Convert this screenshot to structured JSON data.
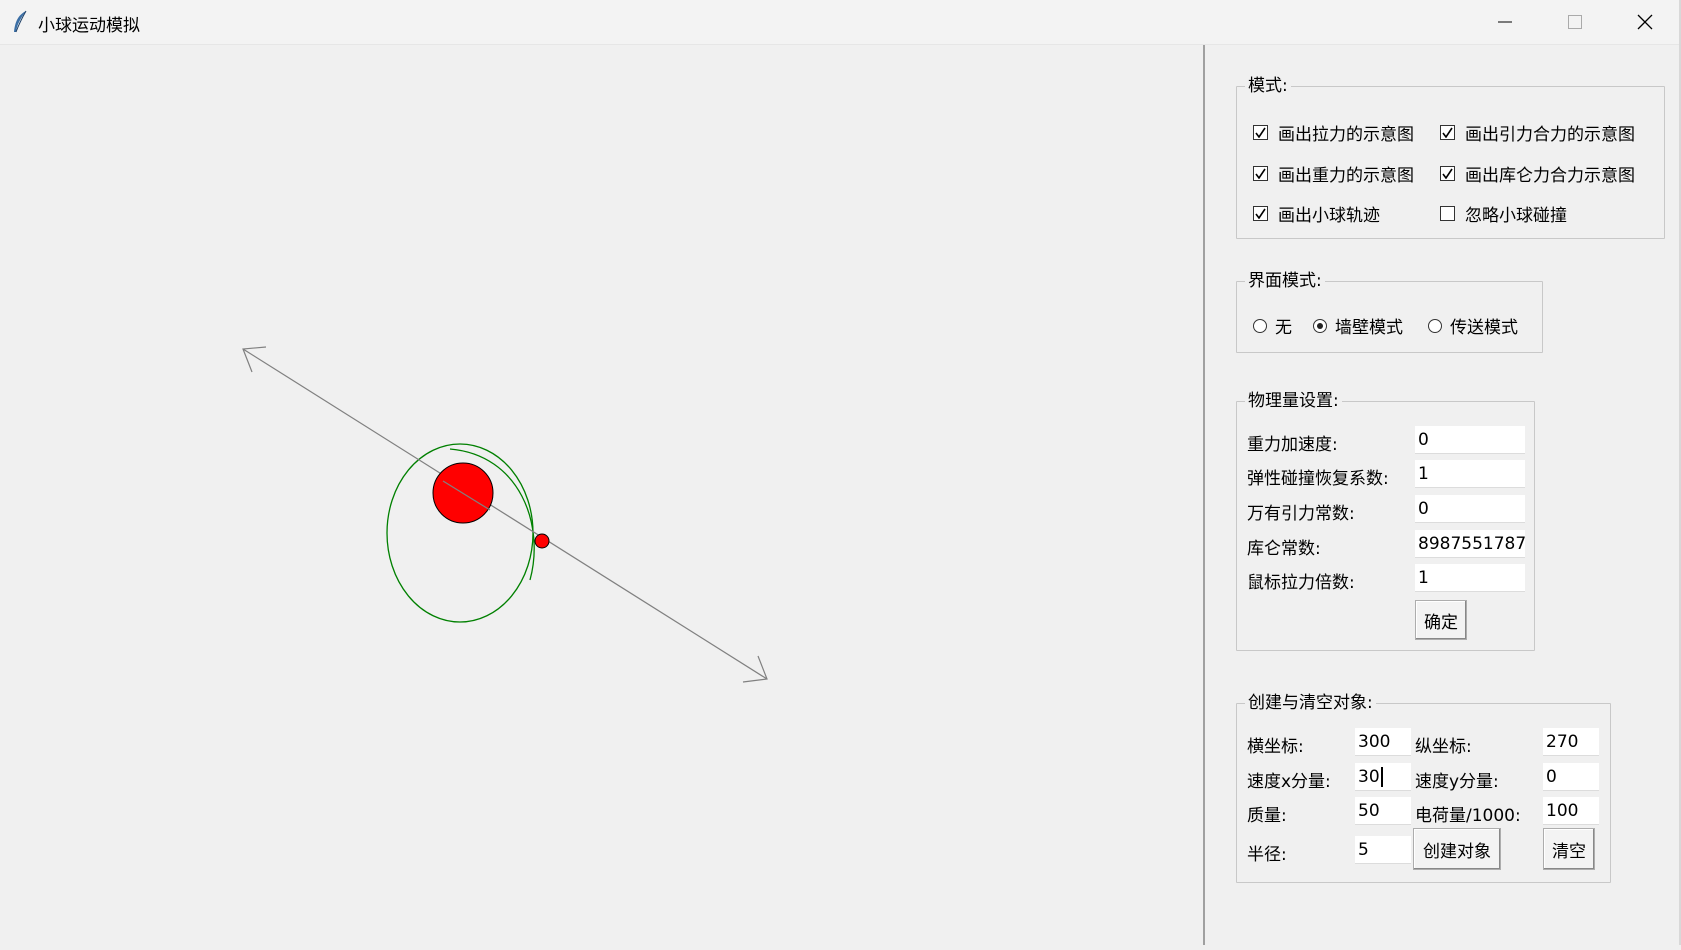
{
  "window": {
    "title": "小球运动模拟"
  },
  "mode_group": {
    "legend": "模式:",
    "checkboxes": [
      {
        "label": "画出拉力的示意图",
        "checked": true
      },
      {
        "label": "画出引力合力的示意图",
        "checked": true
      },
      {
        "label": "画出重力的示意图",
        "checked": true
      },
      {
        "label": "画出库仑力合力示意图",
        "checked": true
      },
      {
        "label": "画出小球轨迹",
        "checked": true
      },
      {
        "label": "忽略小球碰撞",
        "checked": false
      }
    ]
  },
  "boundary_group": {
    "legend": "界面模式:",
    "options": [
      {
        "label": "无",
        "selected": false
      },
      {
        "label": "墙壁模式",
        "selected": true
      },
      {
        "label": "传送模式",
        "selected": false
      }
    ]
  },
  "physics_group": {
    "legend": "物理量设置:",
    "fields": [
      {
        "label": "重力加速度:",
        "value": "0"
      },
      {
        "label": "弹性碰撞恢复系数:",
        "value": "1"
      },
      {
        "label": "万有引力常数:",
        "value": "0"
      },
      {
        "label": "库仑常数:",
        "value": "8987551787"
      },
      {
        "label": "鼠标拉力倍数:",
        "value": "1"
      }
    ],
    "confirm_label": "确定"
  },
  "create_group": {
    "legend": "创建与清空对象:",
    "x_label": "横坐标:",
    "x_value": "300",
    "y_label": "纵坐标:",
    "y_value": "270",
    "vx_label": "速度x分量:",
    "vx_value": "30",
    "vy_label": "速度y分量:",
    "vy_value": "0",
    "mass_label": "质量:",
    "mass_value": "50",
    "charge_label": "电荷量/1000:",
    "charge_value": "100",
    "radius_label": "半径:",
    "radius_value": "5",
    "create_label": "创建对象",
    "clear_label": "清空"
  },
  "colors": {
    "ball": "#ff0000",
    "trajectory": "#008000",
    "arrow": "#808080"
  },
  "icons": [
    "feather-icon",
    "minimize-icon",
    "maximize-icon",
    "close-icon",
    "checkmark-icon"
  ]
}
